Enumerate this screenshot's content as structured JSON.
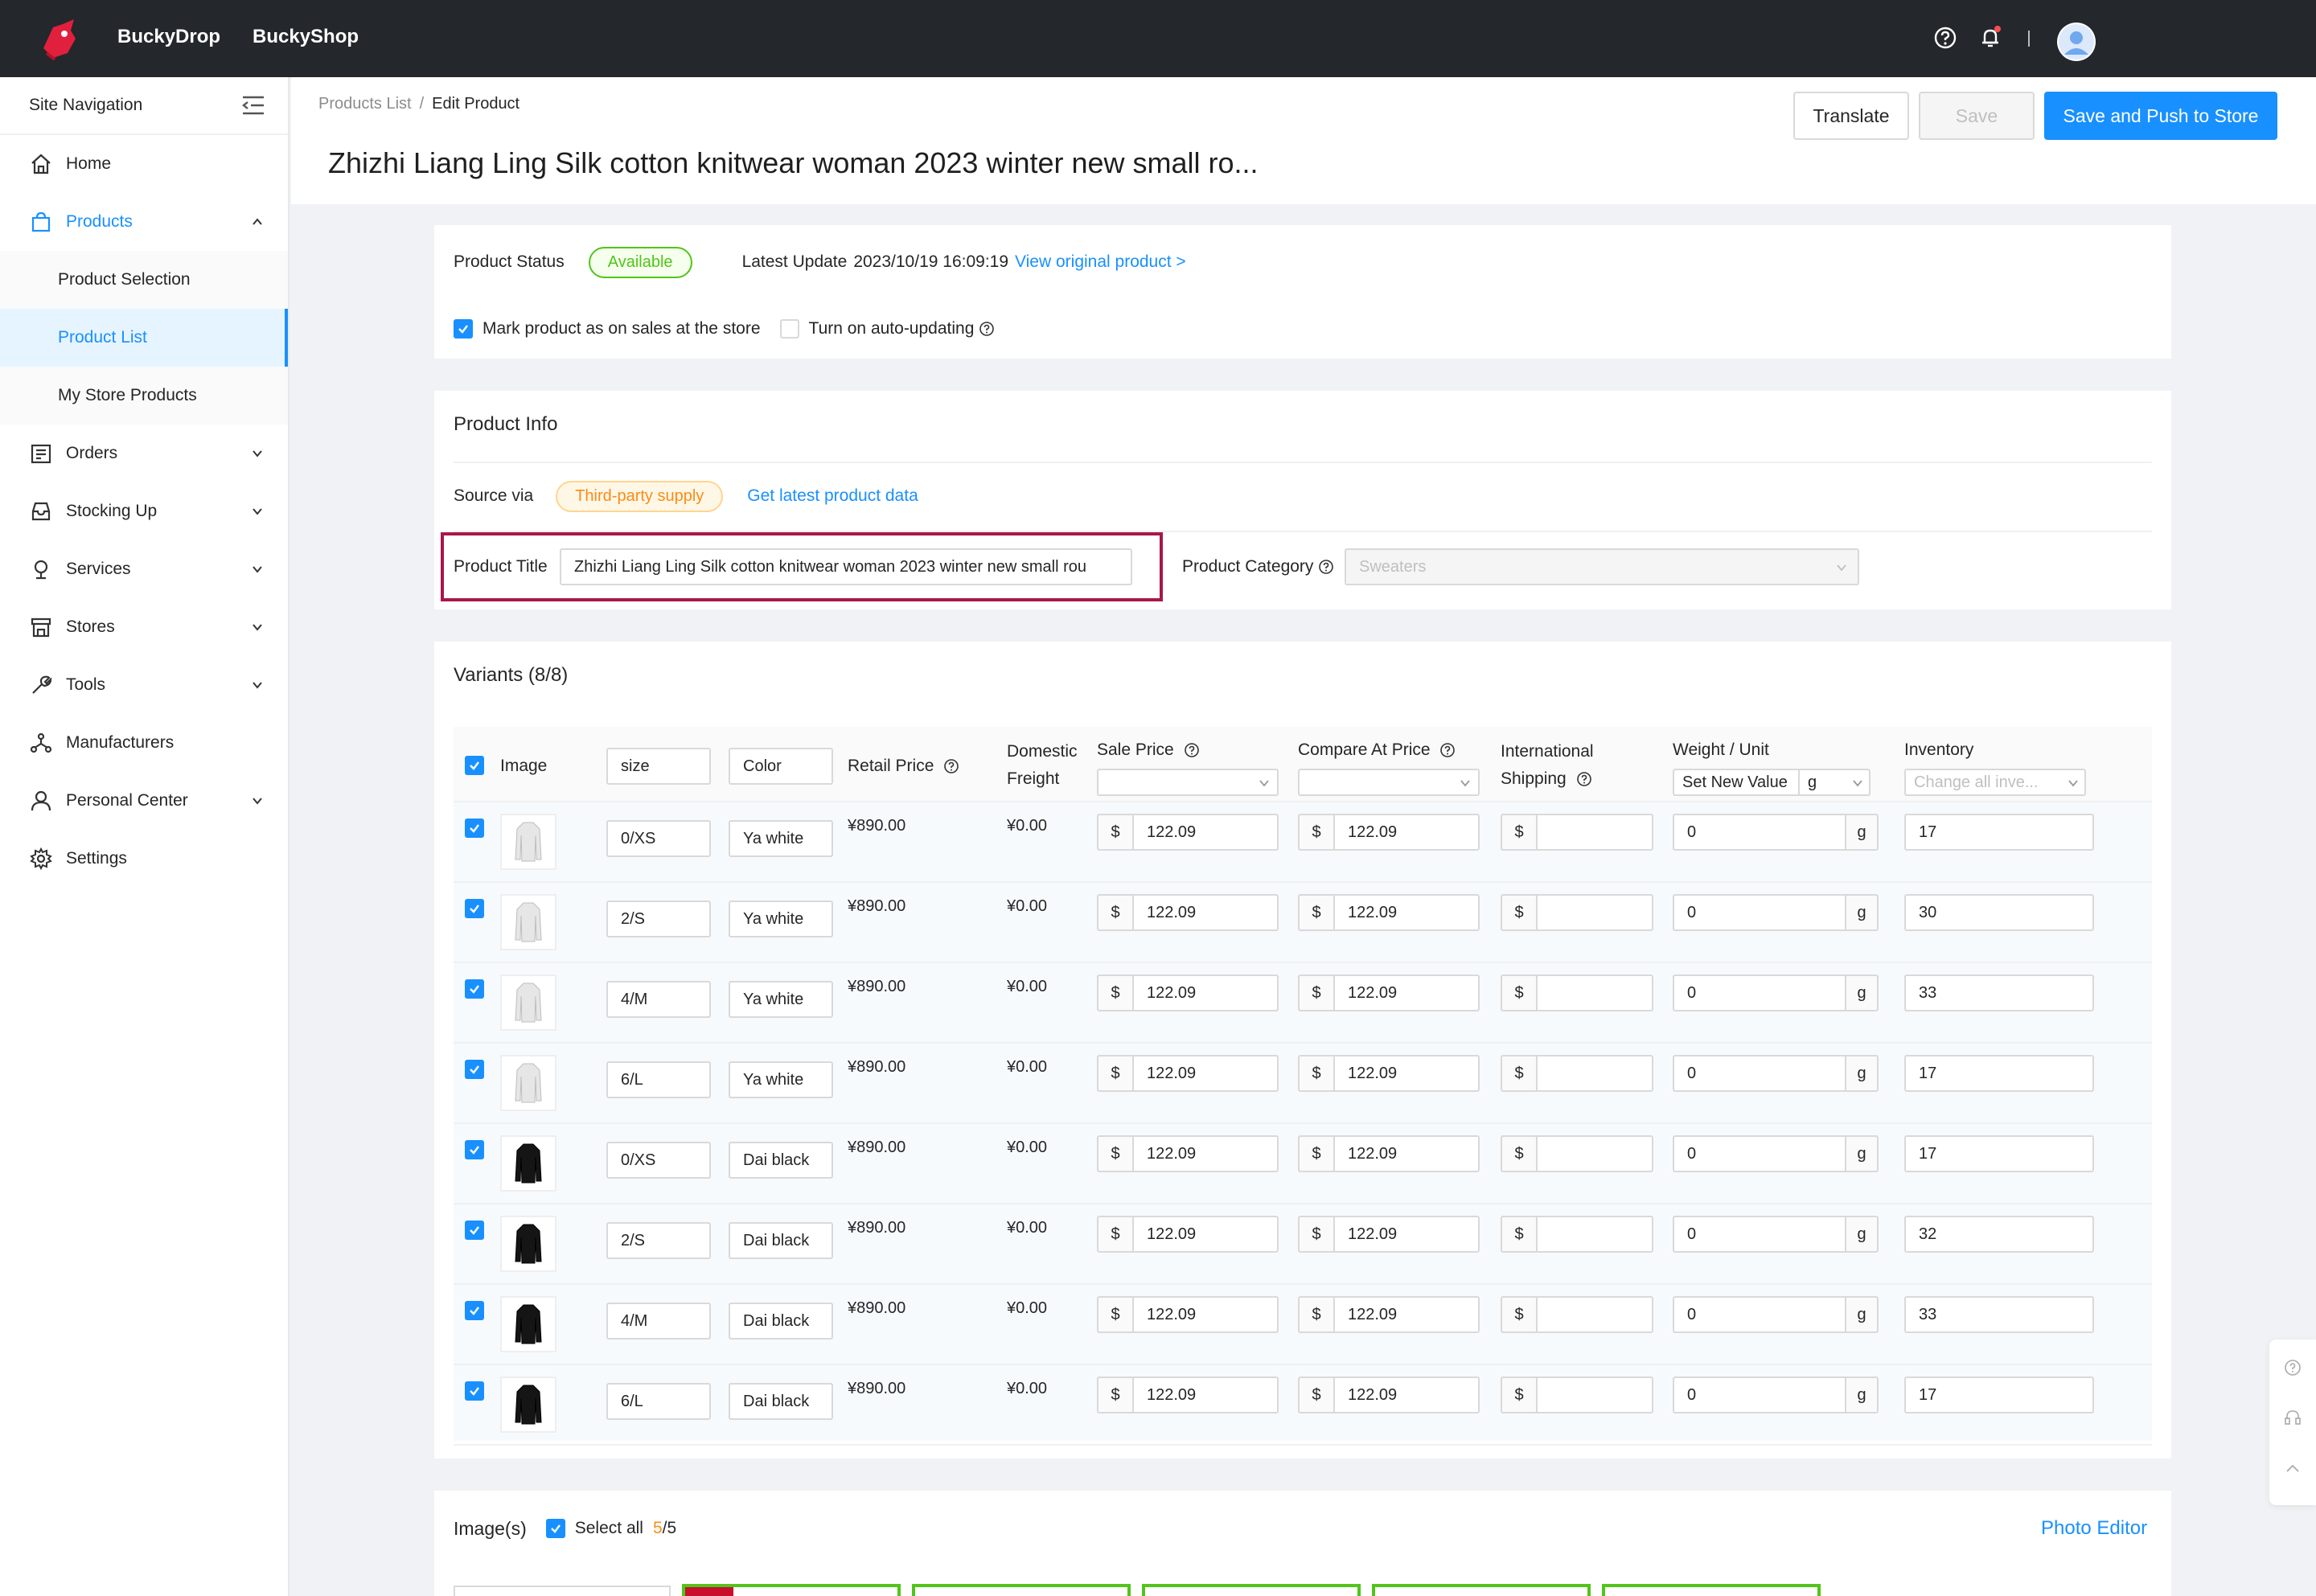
{
  "topbar": {
    "brand_primary": "BuckyDrop",
    "brand_secondary": "BuckyShop"
  },
  "sidebar": {
    "header": "Site Navigation",
    "items": [
      {
        "label": "Home",
        "icon": "home-icon"
      },
      {
        "label": "Products",
        "icon": "shopping-bag-icon",
        "expanded": true
      },
      {
        "label": "Orders",
        "icon": "orders-icon"
      },
      {
        "label": "Stocking Up",
        "icon": "inbox-icon"
      },
      {
        "label": "Services",
        "icon": "services-icon"
      },
      {
        "label": "Stores",
        "icon": "store-icon"
      },
      {
        "label": "Tools",
        "icon": "wrench-icon"
      },
      {
        "label": "Manufacturers",
        "icon": "network-icon"
      },
      {
        "label": "Personal Center",
        "icon": "user-icon"
      },
      {
        "label": "Settings",
        "icon": "gear-icon"
      }
    ],
    "product_sub": [
      "Product Selection",
      "Product List",
      "My Store Products"
    ]
  },
  "header": {
    "breadcrumb_parent": "Products List",
    "breadcrumb_sep": "/",
    "breadcrumb_current": "Edit Product",
    "title": "Zhizhi Liang Ling Silk cotton knitwear woman 2023 winter new small ro...",
    "translate_label": "Translate",
    "save_label": "Save",
    "push_label": "Save and Push to Store"
  },
  "status": {
    "label": "Product Status",
    "value": "Available",
    "latest_update_label": "Latest Update",
    "latest_update_value": "2023/10/19 16:09:19",
    "view_original": "View original product >",
    "mark_on_sale": "Mark product as on sales at the store",
    "auto_update": "Turn on auto-updating"
  },
  "product_info": {
    "title": "Product Info",
    "source_label": "Source via",
    "source_value": "Third-party supply",
    "get_latest": "Get latest product data",
    "product_title_label": "Product Title",
    "product_title_value": "Zhizhi Liang Ling Silk cotton knitwear woman 2023 winter new small rou",
    "category_label": "Product Category",
    "category_value": "Sweaters"
  },
  "variants": {
    "title": "Variants (8/8)",
    "headers": {
      "image": "Image",
      "size": "size",
      "color": "Color",
      "retail": "Retail Price",
      "domestic_1": "Domestic",
      "domestic_2": "Freight",
      "sale": "Sale Price",
      "compare": "Compare At Price",
      "intl_1": "International",
      "intl_2": "Shipping",
      "weight": "Weight / Unit",
      "weight_set": "Set New Value",
      "weight_unit": "g",
      "inventory": "Inventory",
      "inventory_change": "Change all inve..."
    },
    "currency": "$",
    "unit": "g",
    "rows": [
      {
        "size": "0/XS",
        "color": "Ya white",
        "retail": "¥890.00",
        "freight": "¥0.00",
        "sale": "122.09",
        "compare": "122.09",
        "intl": "",
        "weight": "0",
        "inventory": "17",
        "shade": "white"
      },
      {
        "size": "2/S",
        "color": "Ya white",
        "retail": "¥890.00",
        "freight": "¥0.00",
        "sale": "122.09",
        "compare": "122.09",
        "intl": "",
        "weight": "0",
        "inventory": "30",
        "shade": "white"
      },
      {
        "size": "4/M",
        "color": "Ya white",
        "retail": "¥890.00",
        "freight": "¥0.00",
        "sale": "122.09",
        "compare": "122.09",
        "intl": "",
        "weight": "0",
        "inventory": "33",
        "shade": "white"
      },
      {
        "size": "6/L",
        "color": "Ya white",
        "retail": "¥890.00",
        "freight": "¥0.00",
        "sale": "122.09",
        "compare": "122.09",
        "intl": "",
        "weight": "0",
        "inventory": "17",
        "shade": "white"
      },
      {
        "size": "0/XS",
        "color": "Dai black",
        "retail": "¥890.00",
        "freight": "¥0.00",
        "sale": "122.09",
        "compare": "122.09",
        "intl": "",
        "weight": "0",
        "inventory": "17",
        "shade": "black"
      },
      {
        "size": "2/S",
        "color": "Dai black",
        "retail": "¥890.00",
        "freight": "¥0.00",
        "sale": "122.09",
        "compare": "122.09",
        "intl": "",
        "weight": "0",
        "inventory": "32",
        "shade": "black"
      },
      {
        "size": "4/M",
        "color": "Dai black",
        "retail": "¥890.00",
        "freight": "¥0.00",
        "sale": "122.09",
        "compare": "122.09",
        "intl": "",
        "weight": "0",
        "inventory": "33",
        "shade": "black"
      },
      {
        "size": "6/L",
        "color": "Dai black",
        "retail": "¥890.00",
        "freight": "¥0.00",
        "sale": "122.09",
        "compare": "122.09",
        "intl": "",
        "weight": "0",
        "inventory": "17",
        "shade": "black"
      }
    ]
  },
  "images": {
    "title": "Image(s)",
    "select_all": "Select all",
    "selected": "5",
    "sep": " / ",
    "total": "5",
    "photo_editor": "Photo Editor"
  },
  "colors": {
    "accent": "#1890ff",
    "topbar": "#24272b",
    "success": "#52c41a",
    "warning": "#fa8c16",
    "highlight": "#a8174a"
  }
}
